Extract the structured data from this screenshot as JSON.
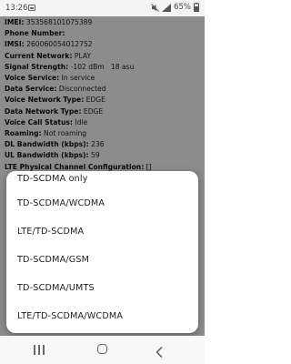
{
  "status_bar": {
    "time": "13:26",
    "battery_percent": "65%",
    "icons": [
      "image-icon",
      "mute-icon",
      "signal-icon",
      "battery-icon"
    ]
  },
  "info_rows": [
    {
      "label": "IMEI:",
      "value": "353568101075389"
    },
    {
      "label": "Phone Number:",
      "value": ""
    },
    {
      "label": "IMSI:",
      "value": "260060054012752"
    },
    {
      "label": "Current Network:",
      "value": "PLAY"
    },
    {
      "label": "Signal Strength:",
      "value": "-102 dBm   18 asu"
    },
    {
      "label": "Voice Service:",
      "value": "In service"
    },
    {
      "label": "Data Service:",
      "value": "Disconnected"
    },
    {
      "label": "Voice Network Type:",
      "value": "EDGE"
    },
    {
      "label": "Data Network Type:",
      "value": "EDGE"
    },
    {
      "label": "Voice Call Status:",
      "value": "Idle"
    },
    {
      "label": "Roaming:",
      "value": "Not roaming"
    },
    {
      "label": "DL Bandwidth (kbps):",
      "value": "236"
    },
    {
      "label": "UL Bandwidth (kbps):",
      "value": "59"
    },
    {
      "label": "LTE Physical Channel Configuration:",
      "value": "[]"
    }
  ],
  "dialog": {
    "options": [
      "TD-SCDMA only",
      "TD-SCDMA/WCDMA",
      "LTE/TD-SCDMA",
      "TD-SCDMA/GSM",
      "TD-SCDMA/UMTS",
      "LTE/TD-SCDMA/WCDMA"
    ]
  },
  "nav_bar": {
    "buttons": [
      "recents-icon",
      "home-icon",
      "back-icon"
    ]
  },
  "colors": {
    "scrim": "#000000",
    "dialog_bg": "#ffffff",
    "status_bar_bg": "#f4f4f4",
    "nav_bar_bg": "#f8f8f8"
  }
}
